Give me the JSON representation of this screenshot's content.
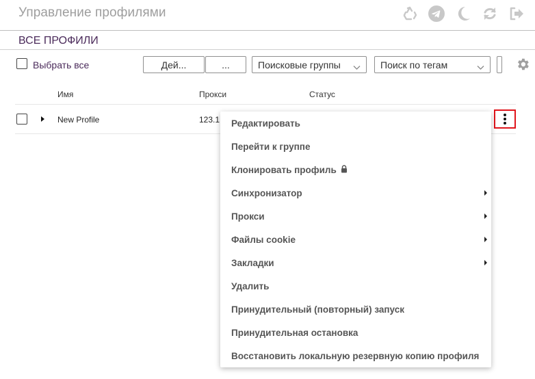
{
  "app": {
    "title": "Управление профилями"
  },
  "header_icons": [
    "recycle-icon",
    "telegram-icon",
    "moon-icon",
    "sync-icon",
    "logout-icon"
  ],
  "section": {
    "title": "ВСЕ ПРОФИЛИ"
  },
  "toolbar": {
    "select_all_label": "Выбрать все",
    "actions_label": "Дей...",
    "more_label": "...",
    "search_groups": {
      "value": "Поисковые группы"
    },
    "search_tags": {
      "value": "Поиск по тегам"
    }
  },
  "table": {
    "headers": [
      "Имя",
      "Прокси",
      "Статус"
    ],
    "rows": [
      {
        "name": "New Profile",
        "proxy": "123.1"
      }
    ]
  },
  "context_menu": {
    "items": [
      {
        "label": "Редактировать"
      },
      {
        "label": "Перейти к группе"
      },
      {
        "label": "Клонировать профиль",
        "icon": "lock-icon"
      },
      {
        "label": "Синхронизатор",
        "submenu": true
      },
      {
        "label": "Прокси",
        "submenu": true
      },
      {
        "label": "Файлы cookie",
        "submenu": true
      },
      {
        "label": "Закладки",
        "submenu": true
      },
      {
        "label": "Удалить"
      },
      {
        "label": "Принудительный (повторный) запуск"
      },
      {
        "label": "Принудительная остановка"
      },
      {
        "label": "Восстановить локальную резервную копию профиля"
      }
    ]
  },
  "colors": {
    "highlight_border": "#e0131a",
    "header_text": "#9e9e9e",
    "accent_text": "#4a2a5a"
  }
}
